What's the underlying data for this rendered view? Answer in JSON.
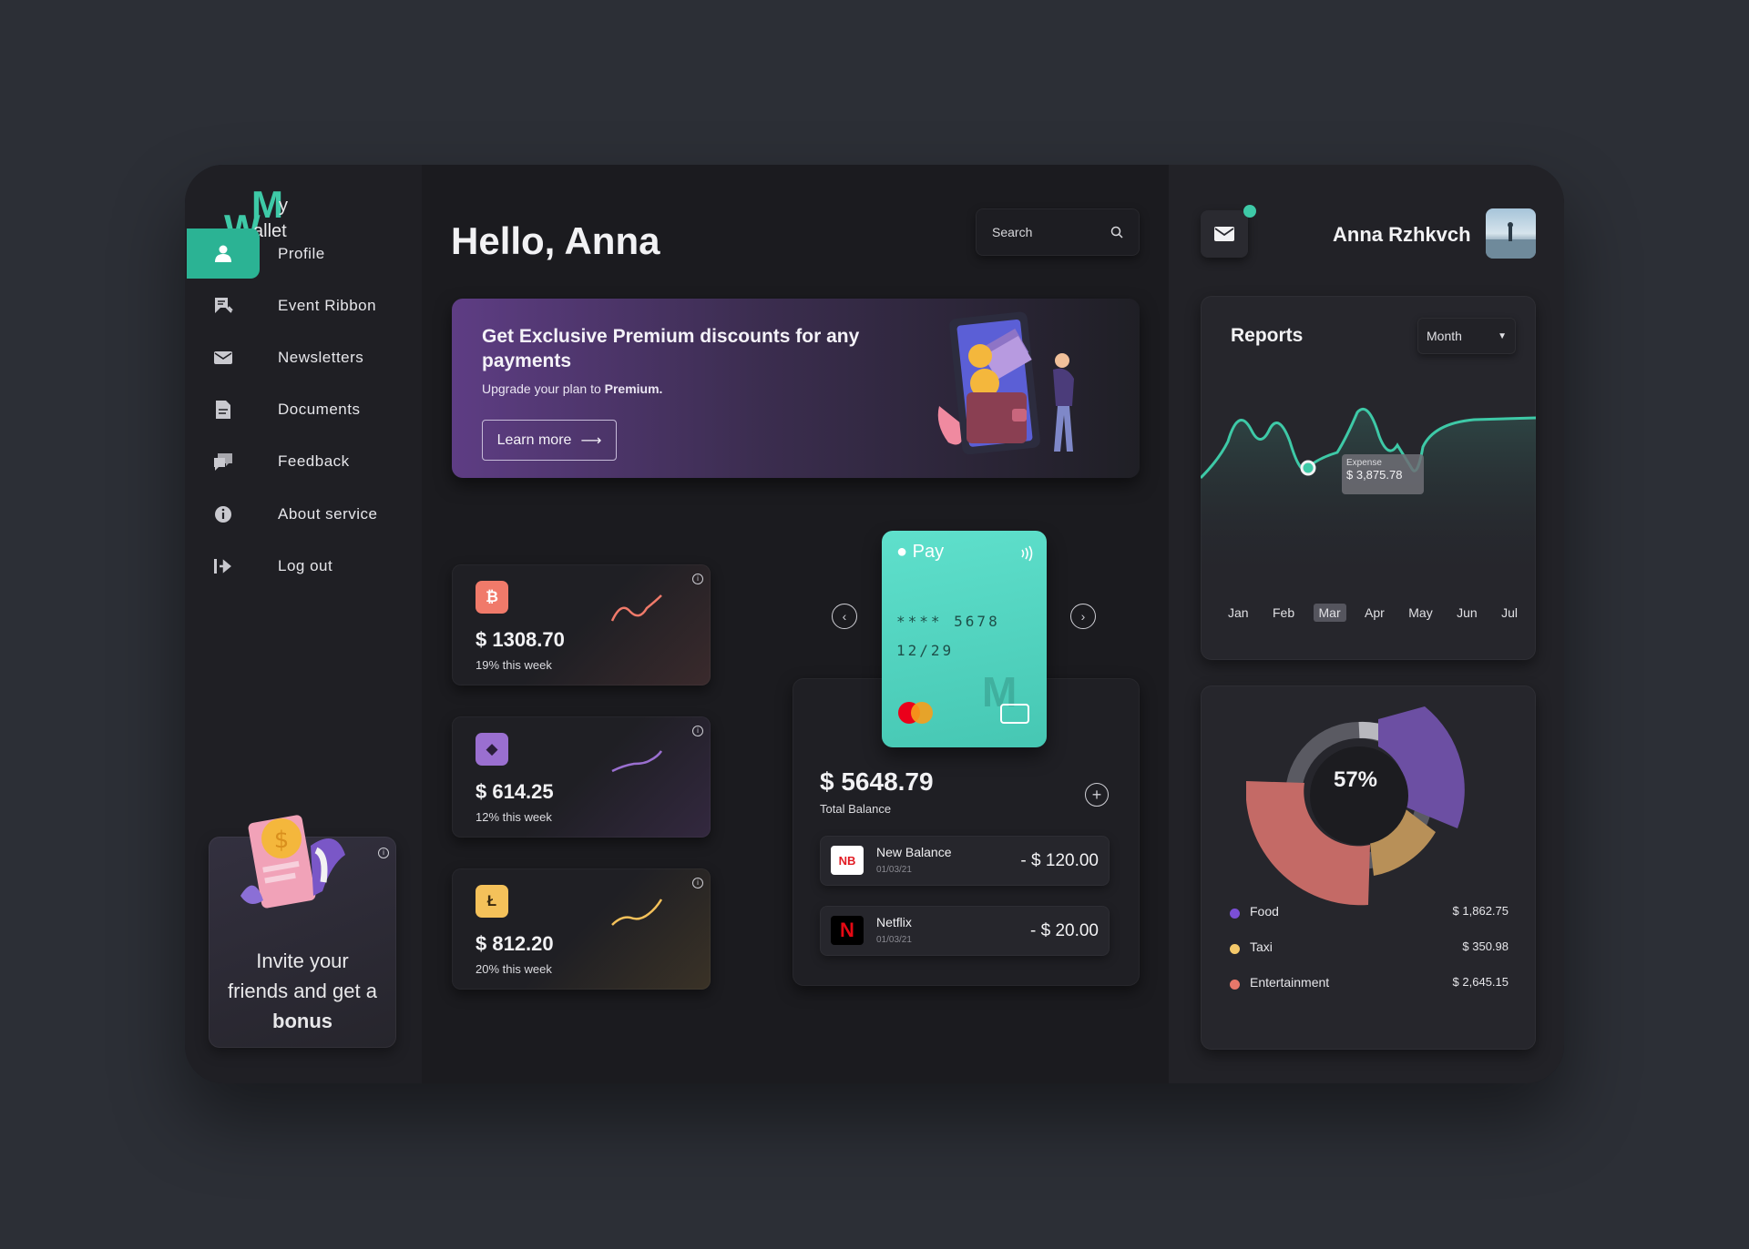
{
  "brand": {
    "logo_m": "M",
    "logo_y": "y",
    "logo_w": "W",
    "logo_allet": "allet"
  },
  "sidebar": {
    "items": [
      {
        "label": "Profile",
        "icon": "user-icon",
        "active": true
      },
      {
        "label": "Event Ribbon",
        "icon": "ribbon-icon"
      },
      {
        "label": "Newsletters",
        "icon": "envelope-icon"
      },
      {
        "label": "Documents",
        "icon": "document-icon"
      },
      {
        "label": "Feedback",
        "icon": "chat-icon"
      },
      {
        "label": "About service",
        "icon": "info-icon"
      },
      {
        "label": "Log out",
        "icon": "logout-icon"
      }
    ],
    "invite": {
      "line1": "Invite your",
      "line2": "friends and get a",
      "bold": "bonus"
    }
  },
  "header": {
    "greeting": "Hello, Anna",
    "search_placeholder": "Search"
  },
  "promo": {
    "title": "Get Exclusive Premium discounts for any payments",
    "subtitle_prefix": "Upgrade your plan to ",
    "subtitle_bold": "Premium.",
    "button": "Learn more"
  },
  "crypto": [
    {
      "symbol": "₿",
      "amount": "$ 1308.70",
      "change": "19% this week",
      "color": "#f07a6a"
    },
    {
      "symbol": "◆",
      "amount": "$ 614.25",
      "change": "12% this week",
      "color": "#9a6fd0"
    },
    {
      "symbol": "Ł",
      "amount": "$ 812.20",
      "change": "20% this week",
      "color": "#f4c15a"
    }
  ],
  "card": {
    "brand": " Pay",
    "number": "**** 5678",
    "expiry": "12/29",
    "watermark": "M"
  },
  "balance": {
    "total": "$ 5648.79",
    "label": "Total Balance"
  },
  "transactions": [
    {
      "name": "New Balance",
      "date": "01/03/21",
      "amount": "- $ 120.00",
      "logo": "NB"
    },
    {
      "name": "Netflix",
      "date": "01/03/21",
      "amount": "- $ 20.00",
      "logo": "N"
    }
  ],
  "user": {
    "name": "Anna Rzhkvch"
  },
  "reports": {
    "title": "Reports",
    "period": "Month",
    "months": [
      "Jan",
      "Feb",
      "Mar",
      "Apr",
      "May",
      "Jun",
      "Jul"
    ],
    "selected_month": "Mar",
    "tooltip_label": "Expense",
    "tooltip_value": "$ 3,875.78"
  },
  "spending": {
    "center": "57%",
    "items": [
      {
        "label": "Food",
        "value": "$ 1,862.75",
        "color": "#7b4fd6"
      },
      {
        "label": "Taxi",
        "value": "$ 350.98",
        "color": "#f4c86a"
      },
      {
        "label": "Entertainment",
        "value": "$ 2,645.15",
        "color": "#e8776a"
      }
    ]
  },
  "colors": {
    "accent": "#2bb394",
    "background": "#2c2f36",
    "panel": "#1d1d21"
  }
}
